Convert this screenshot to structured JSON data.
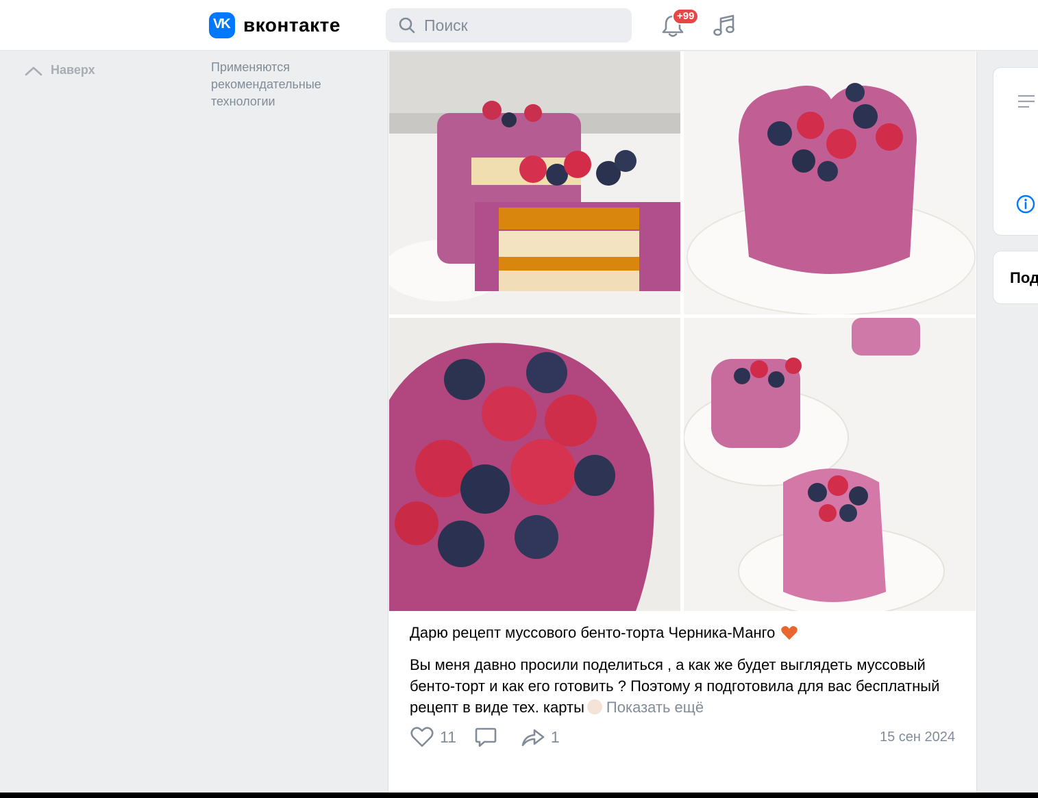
{
  "header": {
    "logo_text": "вконтакте",
    "search_placeholder": "Поиск",
    "notifications_badge": "+99"
  },
  "sidebar": {
    "to_top_label": "Наверх",
    "recommendation_note": "Применяются рекомендательные технологии"
  },
  "post": {
    "title": "Дарю рецепт муссового бенто-торта Черника-Манго",
    "text": "Вы меня давно просили поделиться , а как же будет выглядеть муссовый бенто-торт и как его готовить ? Поэтому я подготовила для вас бесплатный рецепт в виде тех. карты",
    "show_more": "Показать ещё",
    "likes": "11",
    "shares": "1",
    "date": "15 сен 2024"
  },
  "right_panel": {
    "subscribe_partial": "Под"
  },
  "colors": {
    "brand": "#0077ff",
    "badge": "#e64646",
    "muted": "#818c99",
    "background": "#edeef0"
  },
  "icons": [
    "vk-logo-icon",
    "search-icon",
    "bell-icon",
    "music-icon",
    "chevron-up-icon",
    "heart-icon",
    "comment-icon",
    "share-icon",
    "menu-lines-icon",
    "info-icon"
  ]
}
